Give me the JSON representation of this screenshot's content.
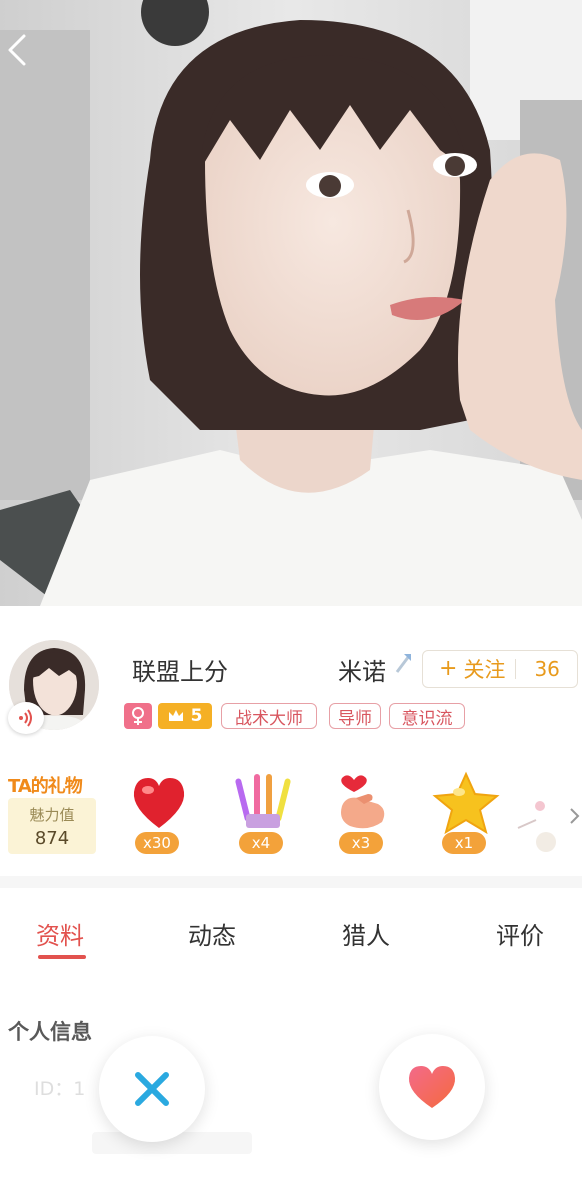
{
  "profile": {
    "name_left": "联盟上分",
    "name_right": "米诺",
    "follow_label": "关注",
    "follow_count": "36",
    "level": "5",
    "tags": [
      "战术大师",
      "导师",
      "意识流"
    ]
  },
  "gifts": {
    "title": "TA的礼物",
    "charm_label": "魅力值",
    "charm_value": "874",
    "items": [
      {
        "icon": "heart-gift-icon",
        "count": "x30"
      },
      {
        "icon": "glowstick-gift-icon",
        "count": "x4"
      },
      {
        "icon": "finger-heart-gift-icon",
        "count": "x3"
      },
      {
        "icon": "star-gift-icon",
        "count": "x1"
      }
    ]
  },
  "tabs": [
    {
      "label": "资料",
      "active": true
    },
    {
      "label": "动态",
      "active": false
    },
    {
      "label": "猎人",
      "active": false
    },
    {
      "label": "评价",
      "active": false
    }
  ],
  "info": {
    "section_title": "个人信息",
    "id_label": "ID：1"
  },
  "colors": {
    "accent": "#e2524e",
    "follow": "#e89a1c",
    "dislike": "#2aa9e0",
    "like": "#f36565"
  }
}
